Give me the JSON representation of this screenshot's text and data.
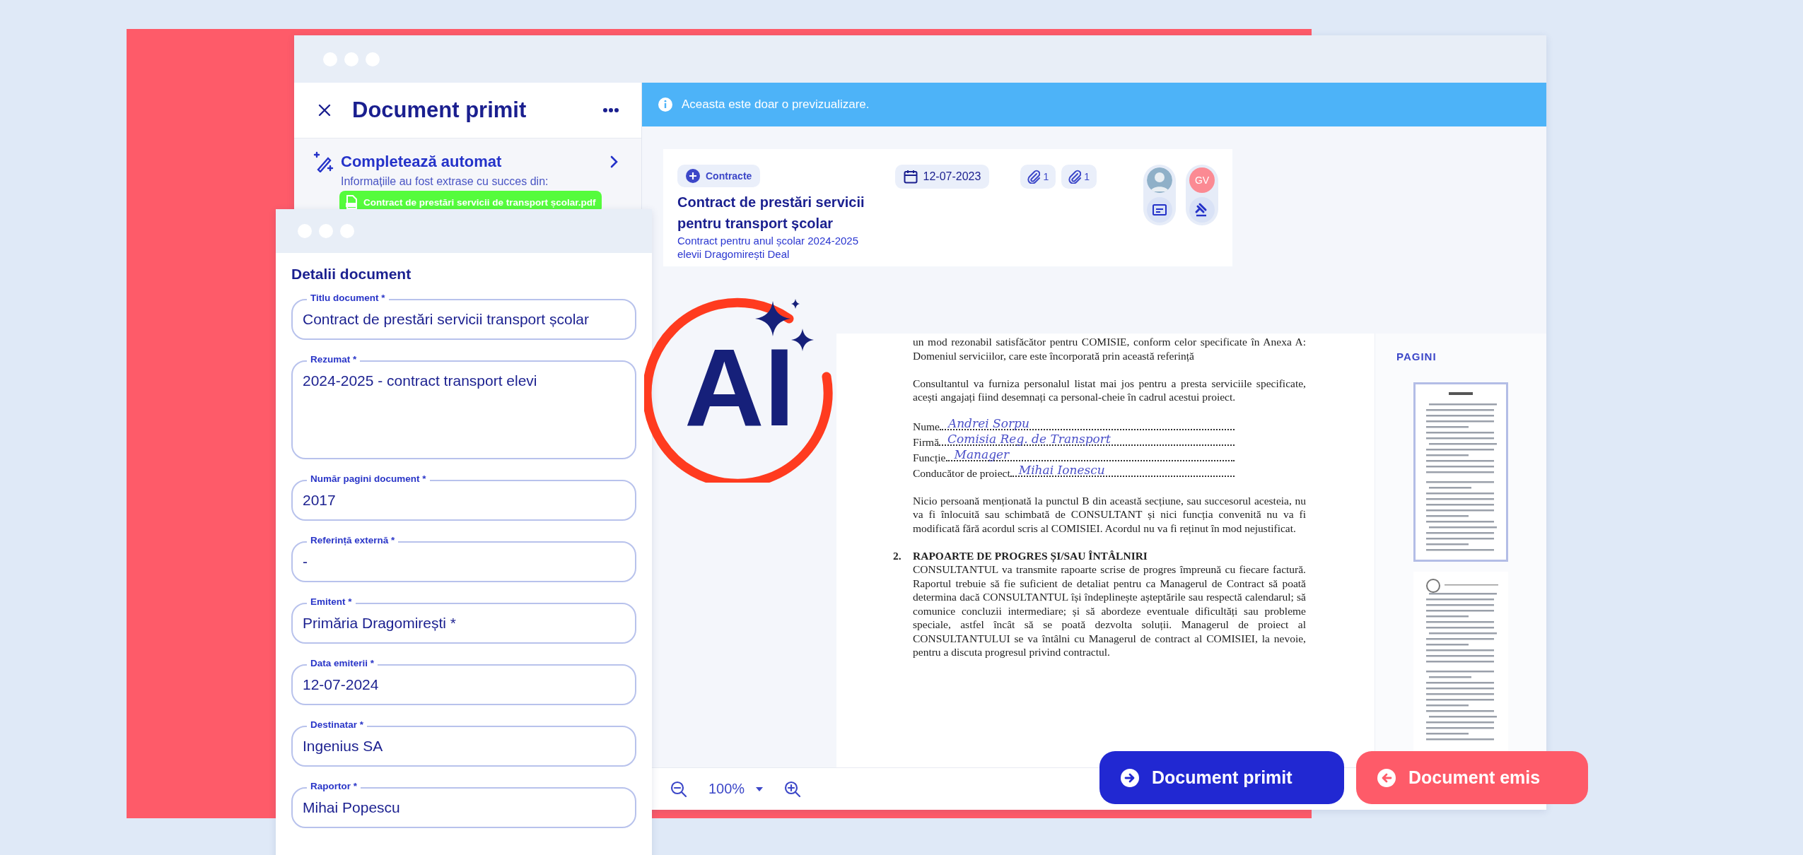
{
  "main_window": {
    "panel": {
      "title": "Document primit",
      "autofill": {
        "title": "Completează automat",
        "subtitle": "Informațiile au fost extrase cu succes din:",
        "file": "Contract de prestări servicii de transport școlar.pdf"
      }
    },
    "banner": "Aceasta este doar o previzualizare.",
    "card": {
      "category": "Contracte",
      "title": "Contract de prestări servicii pentru transport școlar",
      "description": "Contract pentru anul școlar 2024-2025 elevii Dragomirești Deal",
      "date": "12-07-2023",
      "attachments": [
        "1",
        "1"
      ],
      "people": [
        {
          "kind": "photo",
          "role": {
            "kind": "folder"
          }
        },
        {
          "kind": "initials",
          "initials": "GV",
          "role": {
            "kind": "gavel"
          }
        }
      ]
    },
    "document": {
      "blocks": [
        {
          "kind": "paragraph",
          "text": "un mod rezonabil satisfăcător pentru COMISIE, conform celor specificate în Anexa A: Domeniul serviciilor, care este încorporată prin această referință"
        },
        {
          "kind": "paragraph",
          "text": "Consultantul va furniza personalul listat mai jos pentru a presta serviciile specificate, acești angajați fiind desemnați ca personal-cheie în cadrul acestui proiect."
        },
        {
          "kind": "fields",
          "rows": [
            {
              "label": "Nume",
              "value": "Andrei Sorpu"
            },
            {
              "label": "Firmă",
              "value": "Comisia Reg. de Transport"
            },
            {
              "label": "Funcție",
              "value": "Manager"
            },
            {
              "label": "Conducător de proiect",
              "value": "Mihai Ionescu"
            }
          ]
        },
        {
          "kind": "paragraph",
          "text": "Nicio persoană menționată la punctul B din această secțiune, sau succesorul acesteia, nu va fi înlocuită sau schimbată de CONSULTANT și nici funcția convenită nu va fi modificată fără acordul scris al COMISIEI. Acordul nu va fi reținut în mod nejustificat."
        },
        {
          "kind": "heading",
          "number": "2.",
          "text": "RAPOARTE DE PROGRES ȘI/SAU ÎNTÂLNIRI"
        },
        {
          "kind": "indented",
          "text": "CONSULTANTUL va transmite rapoarte scrise de progres împreună cu fiecare factură. Raportul trebuie să fie suficient de detaliat pentru ca Managerul de Contract să poată determina dacă CONSULTANTUL își îndeplinește așteptările sau respectă calendarul; să comunice concluzii intermediare; și să abordeze eventuale dificultăți sau probleme speciale, astfel încât să se poată dezvolta soluții. Managerul de proiect al CONSULTANTULUI se va întâlni cu Managerul de contract al COMISIEI, la nevoie, pentru a discuta progresul privind contractul."
        }
      ]
    },
    "pages_title": "PAGINI",
    "thumbnails": [
      {
        "selected": true
      },
      {
        "selected": false
      }
    ],
    "zoom": "100%"
  },
  "ai_badge": {
    "text": "AI"
  },
  "actions": [
    {
      "label": "Document primit",
      "kind": "incoming"
    },
    {
      "label": "Document emis",
      "kind": "outgoing"
    }
  ],
  "details_window": {
    "title": "Detalii document",
    "fields": [
      {
        "label": "Titlu document *",
        "value": "Contract de prestări servicii transport școlar",
        "kind": "text"
      },
      {
        "label": "Rezumat *",
        "value": "2024-2025 - contract transport elevi",
        "kind": "textarea"
      },
      {
        "label": "Număr pagini document *",
        "value": "2017",
        "kind": "text"
      },
      {
        "label": "Referință externă *",
        "value": "-",
        "kind": "text"
      },
      {
        "label": "Emitent *",
        "value": "Primăria Dragomirești *",
        "kind": "text"
      },
      {
        "label": "Data emiterii *",
        "value": "12-07-2024",
        "kind": "text"
      },
      {
        "label": "Destinatar *",
        "value": "Ingenius SA",
        "kind": "text"
      },
      {
        "label": "Raportor *",
        "value": "Mihai Popescu",
        "kind": "text"
      }
    ]
  }
}
